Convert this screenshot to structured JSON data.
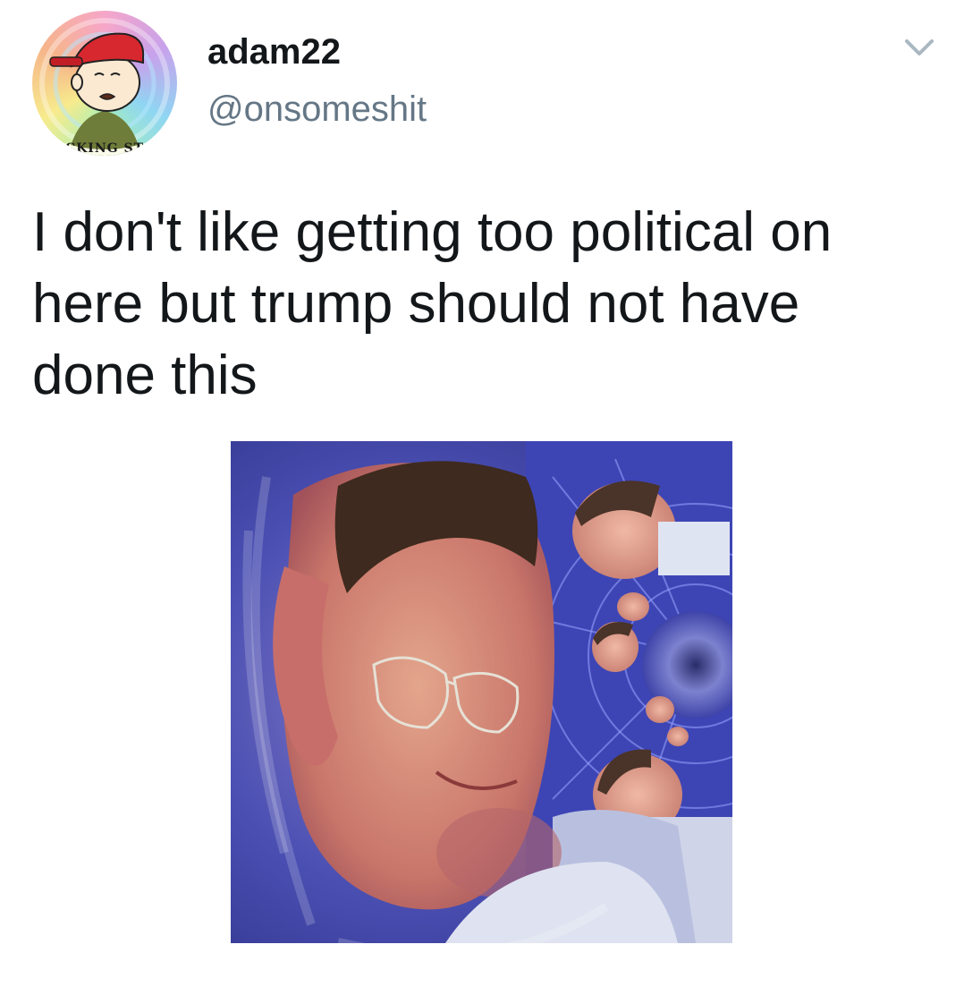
{
  "user": {
    "display_name": "adam22",
    "handle": "@onsomeshit",
    "avatar_icon": "cartoon-avatar",
    "avatar_text": "CKING ST"
  },
  "tweet": {
    "text": "I don't like getting too political on here but trump should not have done this"
  },
  "menu": {
    "icon": "chevron-down-icon"
  },
  "media": {
    "icon": "swirled-kaleidoscope-photo"
  },
  "colors": {
    "text_primary": "#14171a",
    "text_secondary": "#657786",
    "caret": "#aab8c2"
  }
}
